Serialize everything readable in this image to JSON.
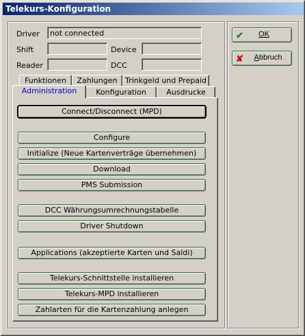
{
  "window": {
    "title": "Telekurs-Konfiguration"
  },
  "status": {
    "driver_label": "Driver",
    "driver_value": "not connected",
    "shift_label": "Shift",
    "shift_value": "",
    "device_label": "Device",
    "device_value": "",
    "reader_label": "Reader",
    "reader_value": "",
    "dcc_label": "DCC",
    "dcc_value": ""
  },
  "tabs": {
    "row_back": [
      "Funktionen",
      "Zahlungen",
      "Trinkgeld und Prepaid"
    ],
    "row_front": [
      "Administration",
      "Konfiguration",
      "Ausdrucke"
    ],
    "active": "Administration"
  },
  "admin_buttons": [
    "Connect/Disconnect (MPD)",
    "Configure",
    "Initialize (Neue Kartenverträge übernehmen)",
    "Download",
    "PMS Submission",
    "DCC Währungsumrechnungstabelle",
    "Driver Shutdown",
    "Applications (akzeptierte Karten und Saldi)",
    "Telekurs-Schnittstelle installieren",
    "Telekurs-MPD installieren",
    "Zahlarten für die Kartenzahlung anlegen"
  ],
  "dialog_buttons": {
    "ok_label": "OK",
    "cancel_label": "Abbruch",
    "ok_icon": "check-icon",
    "cancel_icon": "x-icon",
    "ok_color": "#2e7d32",
    "cancel_color": "#cc0000"
  }
}
